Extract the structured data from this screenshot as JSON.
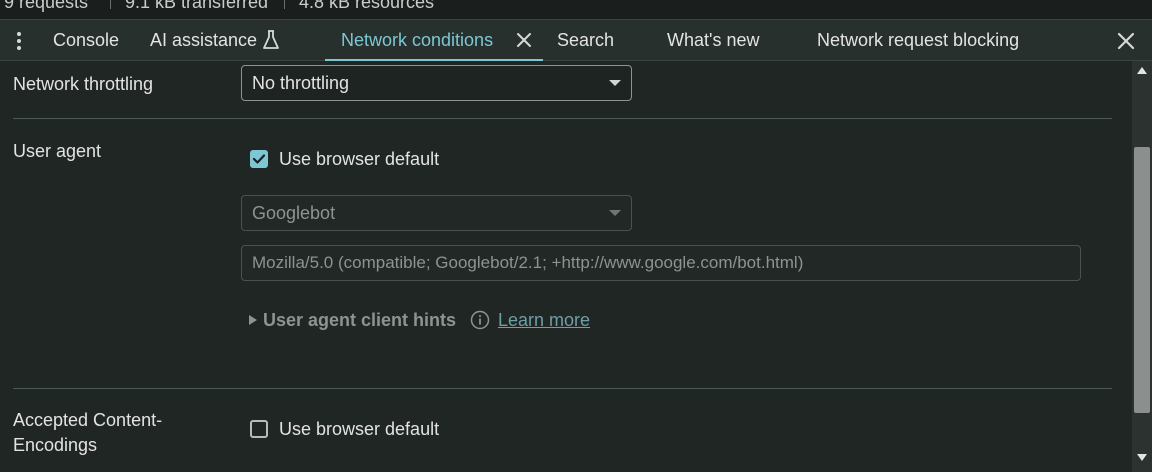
{
  "status": {
    "requests": "9 requests",
    "transferred": "9.1 kB transferred",
    "resources": "4.8 kB resources"
  },
  "tabs": [
    {
      "label": "Console"
    },
    {
      "label": "AI assistance"
    },
    {
      "label": "Network conditions"
    },
    {
      "label": "Search"
    },
    {
      "label": "What's new"
    },
    {
      "label": "Network request blocking"
    }
  ],
  "network_throttling": {
    "label": "Network throttling",
    "value": "No throttling"
  },
  "user_agent": {
    "label": "User agent",
    "use_default_label": "Use browser default",
    "use_default_checked": true,
    "preset_value": "Googlebot",
    "custom_value": "Mozilla/5.0 (compatible; Googlebot/2.1; +http://www.google.com/bot.html)",
    "client_hints_label": "User agent client hints",
    "learn_more": "Learn more"
  },
  "accepted_encodings": {
    "label_line1": "Accepted Content-",
    "label_line2": "Encodings",
    "use_default_label": "Use browser default",
    "use_default_checked": false
  },
  "colors": {
    "accent": "#7cc7d3",
    "background": "#202624",
    "tabbar": "#28302d"
  },
  "icons": [
    "more-vertical-icon",
    "flask-icon",
    "close-icon",
    "check-icon",
    "info-icon",
    "scroll-up-icon",
    "scroll-down-icon"
  ]
}
